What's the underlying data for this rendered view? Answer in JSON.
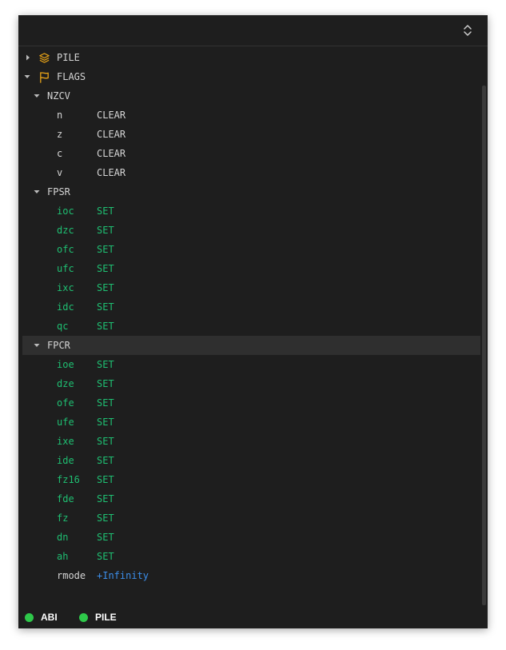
{
  "tree": {
    "pile": {
      "label": "PILE"
    },
    "flags": {
      "label": "FLAGS",
      "nzcv": {
        "label": "NZCV",
        "items": [
          {
            "key": "n",
            "value": "CLEAR"
          },
          {
            "key": "z",
            "value": "CLEAR"
          },
          {
            "key": "c",
            "value": "CLEAR"
          },
          {
            "key": "v",
            "value": "CLEAR"
          }
        ]
      },
      "fpsr": {
        "label": "FPSR",
        "items": [
          {
            "key": "ioc",
            "value": "SET"
          },
          {
            "key": "dzc",
            "value": "SET"
          },
          {
            "key": "ofc",
            "value": "SET"
          },
          {
            "key": "ufc",
            "value": "SET"
          },
          {
            "key": "ixc",
            "value": "SET"
          },
          {
            "key": "idc",
            "value": "SET"
          },
          {
            "key": "qc",
            "value": "SET"
          }
        ]
      },
      "fpcr": {
        "label": "FPCR",
        "items": [
          {
            "key": "ioe",
            "value": "SET"
          },
          {
            "key": "dze",
            "value": "SET"
          },
          {
            "key": "ofe",
            "value": "SET"
          },
          {
            "key": "ufe",
            "value": "SET"
          },
          {
            "key": "ixe",
            "value": "SET"
          },
          {
            "key": "ide",
            "value": "SET"
          },
          {
            "key": "fz16",
            "value": "SET"
          },
          {
            "key": "fde",
            "value": "SET"
          },
          {
            "key": "fz",
            "value": "SET"
          },
          {
            "key": "dn",
            "value": "SET"
          },
          {
            "key": "ah",
            "value": "SET"
          },
          {
            "key": "rmode",
            "value": "+Infinity"
          }
        ]
      }
    }
  },
  "status": {
    "abi": {
      "label": "ABI"
    },
    "pile": {
      "label": "PILE"
    }
  },
  "colors": {
    "set": "#1fbf72",
    "clear": "#d4d4d4",
    "number": "#3b8eea",
    "icon": "#e8a317",
    "status_dot": "#2ec84a"
  },
  "icons": {
    "header": "chevron-up-down-icon",
    "pile": "stack-layers-icon",
    "flags": "flag-icon"
  }
}
